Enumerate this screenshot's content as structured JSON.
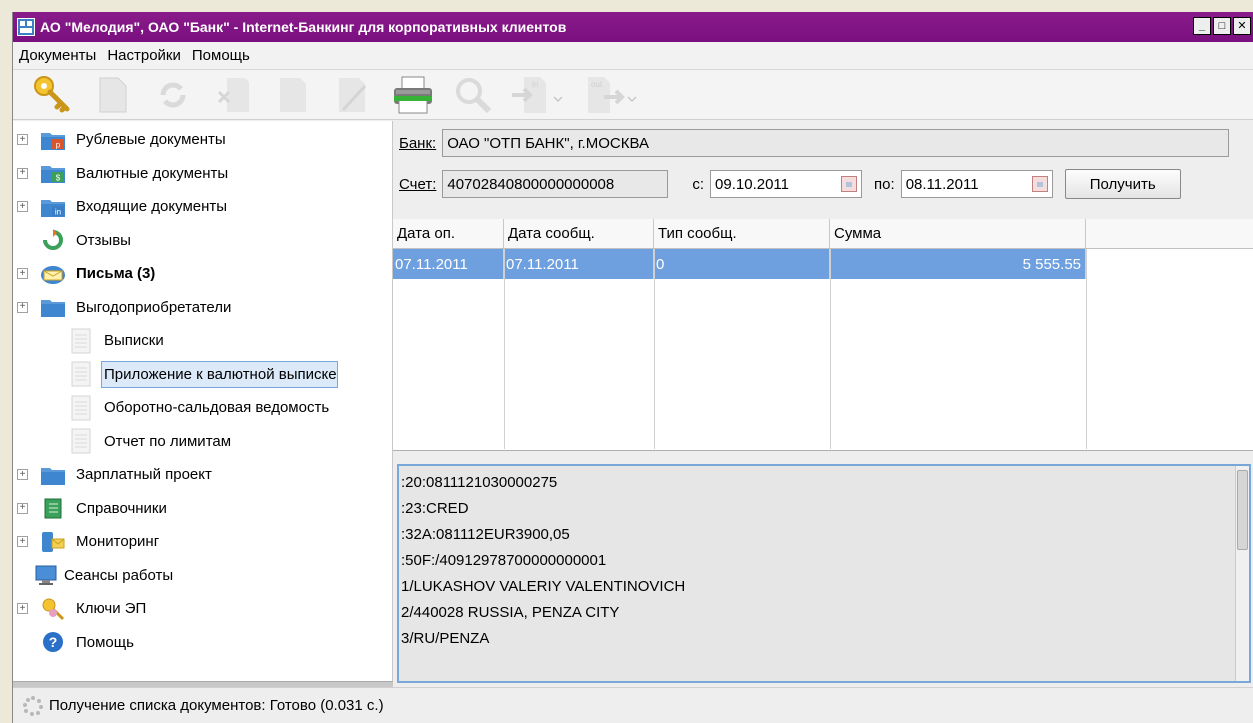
{
  "window": {
    "title": "АО \"Мелодия\", ОАО \"Банк\" - Internet-Банкинг для корпоративных клиентов",
    "controls": {
      "minimize": "_",
      "maximize": "□",
      "close": "✕"
    }
  },
  "menu": [
    "Документы",
    "Настройки",
    "Помощь"
  ],
  "toolbar": [
    {
      "name": "key-icon",
      "enabled": true
    },
    {
      "name": "new-document-icon",
      "enabled": false
    },
    {
      "name": "refresh-icon",
      "enabled": false
    },
    {
      "name": "delete-icon",
      "enabled": false
    },
    {
      "name": "copy-document-icon",
      "enabled": false
    },
    {
      "name": "sign-icon",
      "enabled": false
    },
    {
      "name": "print-icon",
      "enabled": true
    },
    {
      "name": "search-icon",
      "enabled": false
    },
    {
      "name": "import-icon",
      "enabled": false,
      "label": "in"
    },
    {
      "name": "export-icon",
      "enabled": false,
      "label": "out"
    }
  ],
  "tree": [
    {
      "label": "Рублевые документы",
      "icon": "ruble-folder-icon",
      "expandable": true,
      "level": 0,
      "badge": "р"
    },
    {
      "label": "Валютные документы",
      "icon": "currency-folder-icon",
      "expandable": true,
      "level": 0,
      "badge": "$"
    },
    {
      "label": "Входящие документы",
      "icon": "incoming-folder-icon",
      "expandable": true,
      "level": 0,
      "badge": "in"
    },
    {
      "label": "Отзывы",
      "icon": "recall-icon",
      "expandable": false,
      "level": 0
    },
    {
      "label": "Письма (3)",
      "icon": "letters-icon",
      "expandable": true,
      "level": 0,
      "bold": true
    },
    {
      "label": "Выгодоприобретатели",
      "icon": "beneficiaries-folder-icon",
      "expandable": true,
      "level": 0
    },
    {
      "label": "Выписки",
      "icon": "document-icon",
      "expandable": false,
      "level": 1
    },
    {
      "label": "Приложение к валютной выписке",
      "icon": "document-icon",
      "expandable": false,
      "level": 1,
      "selected": true
    },
    {
      "label": "Оборотно-сальдовая ведомость",
      "icon": "document-icon",
      "expandable": false,
      "level": 1
    },
    {
      "label": "Отчет по лимитам",
      "icon": "document-icon",
      "expandable": false,
      "level": 1
    },
    {
      "label": "Зарплатный проект",
      "icon": "salary-folder-icon",
      "expandable": true,
      "level": 0
    },
    {
      "label": "Справочники",
      "icon": "directory-icon",
      "expandable": true,
      "level": 0
    },
    {
      "label": "Мониторинг",
      "icon": "monitoring-icon",
      "expandable": true,
      "level": 0
    },
    {
      "label": "Сеансы работы",
      "icon": "sessions-icon",
      "expandable": false,
      "level": 0,
      "tight": true
    },
    {
      "label": "Ключи ЭП",
      "icon": "keys-icon",
      "expandable": true,
      "level": 0
    },
    {
      "label": "Помощь",
      "icon": "help-icon",
      "expandable": false,
      "level": 0
    }
  ],
  "filters": {
    "bank_label": "Банк:",
    "bank_value": "ОАО \"ОТП БАНК\", г.МОСКВА",
    "account_label": "Счет:",
    "account_value": "40702840800000000008",
    "from_label": "с:",
    "from_value": "09.10.2011",
    "to_label": "по:",
    "to_value": "08.11.2011",
    "get_button": "Получить"
  },
  "grid": {
    "columns": [
      "Дата оп.",
      "Дата сообщ.",
      "Тип сообщ.",
      "Сумма"
    ],
    "rows": [
      {
        "cells": [
          "07.11.2011",
          "07.11.2011",
          "0",
          "5 555.55"
        ],
        "selected": true
      }
    ]
  },
  "detail_lines": [
    ":20:0811121030000275",
    ":23:CRED",
    ":32A:081112EUR3900,05",
    ":50F:/40912978700000000001",
    "1/LUKASHOV VALERIY VALENTINOVICH",
    "2/440028 RUSSIA, PENZA CITY",
    "3/RU/PENZA"
  ],
  "status": "Получение списка документов: Готово (0.031 с.)",
  "colors": {
    "titlebar": "#7a0f80",
    "selection": "#6ea0e0",
    "tree_selection": "#dce9f8"
  }
}
